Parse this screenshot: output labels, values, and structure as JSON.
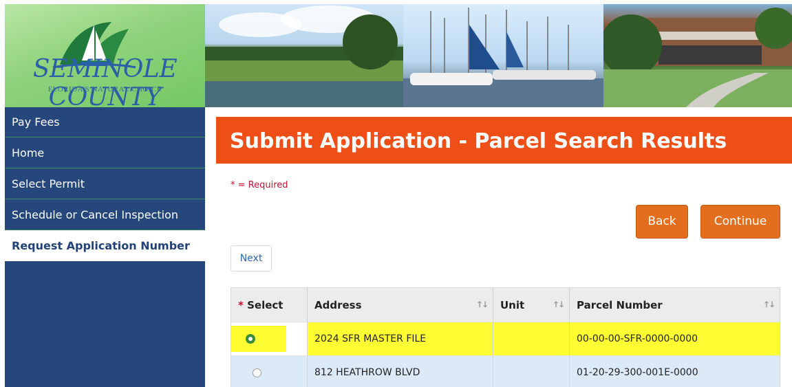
{
  "logo": {
    "title": "SEMINOLE COUNTY",
    "subtitle": "FLORIDA'S NATURAL CHOICE"
  },
  "sidebar": {
    "items": [
      {
        "label": "Pay Fees"
      },
      {
        "label": "Home"
      },
      {
        "label": "Select Permit"
      },
      {
        "label": "Schedule or Cancel Inspection"
      },
      {
        "label": "Request Application Number"
      }
    ]
  },
  "main": {
    "title": "Submit Application - Parcel Search Results",
    "required_note": "* = Required",
    "back_label": "Back",
    "continue_label": "Continue",
    "next_label": "Next"
  },
  "table": {
    "columns": {
      "select_star": "*",
      "select": "Select",
      "address": "Address",
      "unit": "Unit",
      "parcel": "Parcel Number"
    },
    "rows": [
      {
        "selected": true,
        "address": "2024 SFR MASTER FILE",
        "unit": "",
        "parcel": "00-00-00-SFR-0000-0000"
      },
      {
        "selected": false,
        "address": "812 HEATHROW BLVD",
        "unit": "",
        "parcel": "01-20-29-300-001E-0000"
      }
    ]
  },
  "colors": {
    "accent": "#ee4f16",
    "nav_bg": "#26477c",
    "button": "#e36f1e",
    "highlight": "#fffe33"
  }
}
